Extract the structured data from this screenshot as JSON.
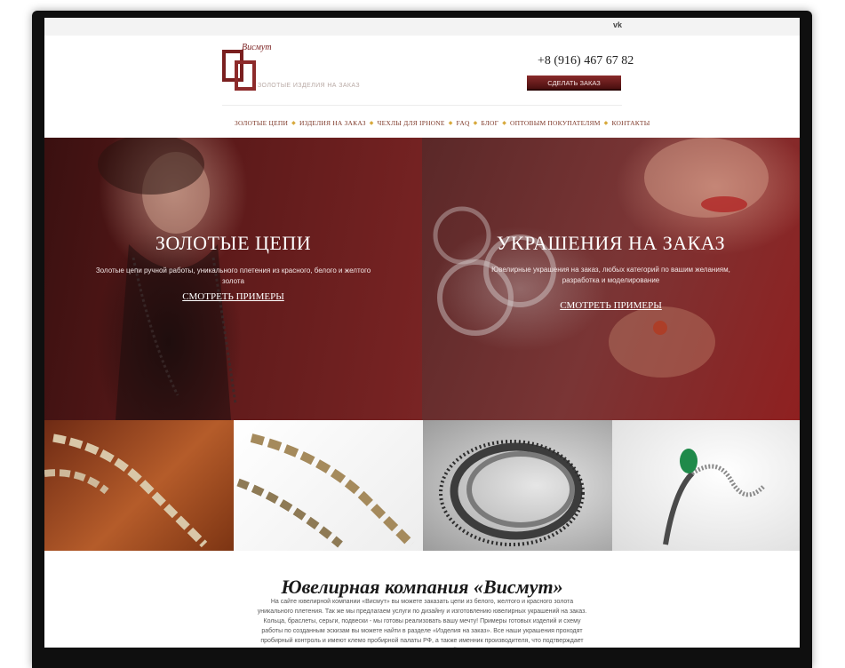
{
  "social": {
    "vk_label": "vk"
  },
  "header": {
    "logo_script": "Висмут",
    "tagline": "ЗОЛОТЫЕ ИЗДЕЛИЯ НА ЗАКАЗ",
    "phone": "+8 (916) 467 67 82",
    "order_button": "СДЕЛАТЬ ЗАКАЗ"
  },
  "nav": {
    "items": [
      "ЗОЛОТЫЕ ЦЕПИ",
      "ИЗДЕЛИЯ НА ЗАКАЗ",
      "ЧЕХЛЫ ДЛЯ IPHONE",
      "FAQ",
      "БЛОГ",
      "ОПТОВЫМ ПОКУПАТЕЛЯМ",
      "КОНТАКТЫ"
    ],
    "separator": "◆"
  },
  "hero": {
    "left": {
      "title": "ЗОЛОТЫЕ ЦЕПИ",
      "desc": "Золотые цепи ручной работы, уникального плетения из красного, белого и желтого золота",
      "link": "СМОТРЕТЬ ПРИМЕРЫ"
    },
    "right": {
      "title": "УКРАШЕНИЯ НА ЗАКАЗ",
      "desc": "Ювелирные украшения на заказ, любых категорий по вашим желаниям, разработка и моделирование",
      "link": "СМОТРЕТЬ ПРИМЕРЫ"
    }
  },
  "about": {
    "title": "Ювелирная компания «Висмут»",
    "text": "На сайте ювелирной компании «Висмут» вы можете заказать цепи из белого, желтого и красного золота уникального плетения. Так же мы предлагаем услуги по дизайну и изготовлению ювелирных украшений на заказ. Кольца, браслеты, серьги, подвески - мы готовы реализовать вашу мечту! Примеры готовых изделий и схему работы по созданным эскизам вы можете найти в разделе «Изделия на заказ». Все наши украшения проходят пробирный контроль и имеют клемо пробирной палаты РФ, а также именник производителя, что подтверждает качество наших изделий."
  },
  "colors": {
    "brand": "#7a2020",
    "button": "#5a1414",
    "nav_text": "#7f3a2a",
    "nav_separator": "#d7a93c"
  }
}
